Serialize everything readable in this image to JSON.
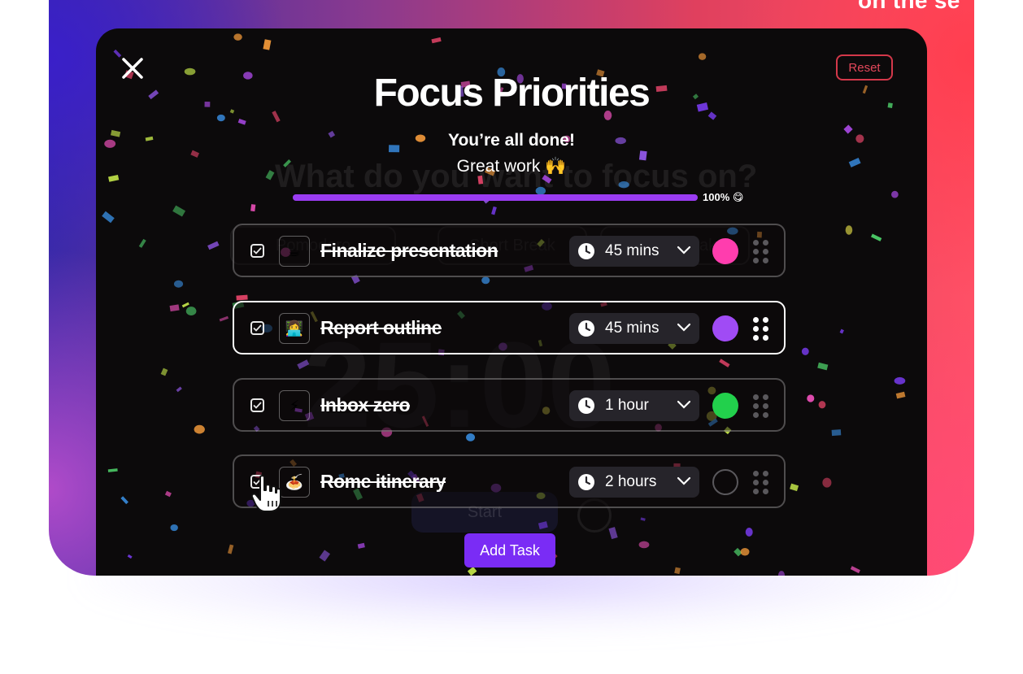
{
  "background": {
    "caption_line": "on the se"
  },
  "dialog": {
    "title": "Focus Priorities",
    "reset_label": "Reset",
    "completion_heading": "You’re all done!",
    "completion_message": "Great work 🙌",
    "progress_percent": 100,
    "progress_label": "100% 😋",
    "add_task_label": "Add Task"
  },
  "tasks": [
    {
      "emoji": "☕",
      "name": "Finalize presentation",
      "duration": "45 mins",
      "completed": true,
      "color": "#ff3dae",
      "active": false
    },
    {
      "emoji": "👩‍💻",
      "name": "Report outline",
      "duration": "45 mins",
      "completed": true,
      "color": "#a04bf5",
      "active": true
    },
    {
      "emoji": "⚡",
      "name": "Inbox zero",
      "duration": "1 hour",
      "completed": true,
      "color": "#22d04c",
      "active": false
    },
    {
      "emoji": "🍝",
      "name": "Rome itinerary",
      "duration": "2 hours",
      "completed": true,
      "color": "",
      "active": false
    }
  ],
  "colors": {
    "accent": "#7a2cf5",
    "progress": "#9a3cf2",
    "reset": "#e2475a",
    "panel": "#0c0a0b"
  },
  "icons": {
    "close": "close-icon",
    "check": "checkmark-icon",
    "clock": "clock-icon",
    "chevron": "chevron-down-icon",
    "grip": "drag-handle-icon",
    "cursor": "hand-pointer-icon"
  }
}
